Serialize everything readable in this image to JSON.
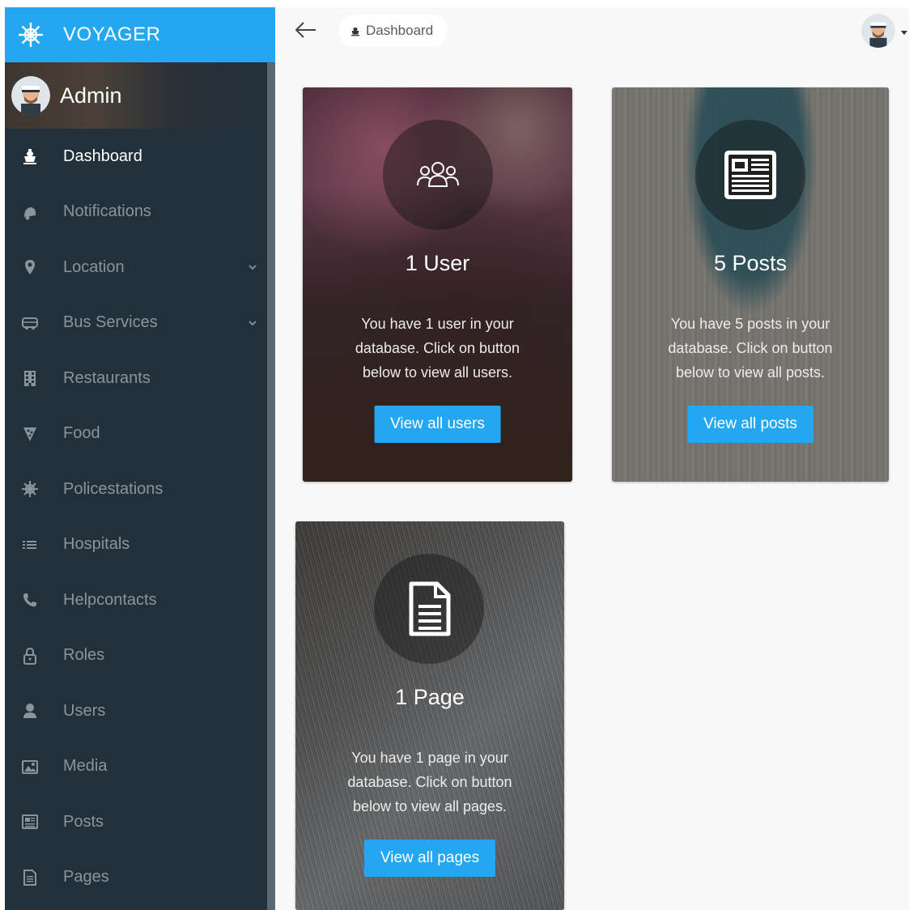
{
  "brand": {
    "title": "VOYAGER",
    "icon": "helm-icon",
    "color": "#22a7f0"
  },
  "profile": {
    "name": "Admin"
  },
  "sidebar": {
    "background": "#22303b",
    "items": [
      {
        "label": "Dashboard",
        "icon": "boat-icon",
        "active": true
      },
      {
        "label": "Notifications",
        "icon": "bell-icon"
      },
      {
        "label": "Location",
        "icon": "map-pin-icon",
        "has_submenu": true
      },
      {
        "label": "Bus Services",
        "icon": "bus-icon",
        "has_submenu": true
      },
      {
        "label": "Restaurants",
        "icon": "building-icon"
      },
      {
        "label": "Food",
        "icon": "food-icon"
      },
      {
        "label": "Policestations",
        "icon": "helm-icon"
      },
      {
        "label": "Hospitals",
        "icon": "list-icon"
      },
      {
        "label": "Helpcontacts",
        "icon": "phone-icon"
      },
      {
        "label": "Roles",
        "icon": "lock-icon"
      },
      {
        "label": "Users",
        "icon": "person-icon"
      },
      {
        "label": "Media",
        "icon": "images-icon"
      },
      {
        "label": "Posts",
        "icon": "news-icon"
      },
      {
        "label": "Pages",
        "icon": "file-text-icon"
      }
    ]
  },
  "topbar": {
    "breadcrumb": "Dashboard"
  },
  "cards": {
    "users": {
      "title": "1 User",
      "text": "You have 1 user in your database. Click on button below to view all users.",
      "button": "View all users",
      "icon": "people-icon"
    },
    "posts": {
      "title": "5 Posts",
      "text": "You have 5 posts in your database. Click on button below to view all posts.",
      "button": "View all posts",
      "icon": "newspaper-icon"
    },
    "pages": {
      "title": "1 Page",
      "text": "You have 1 page in your database. Click on button below to view all pages.",
      "button": "View all pages",
      "icon": "document-icon"
    }
  }
}
